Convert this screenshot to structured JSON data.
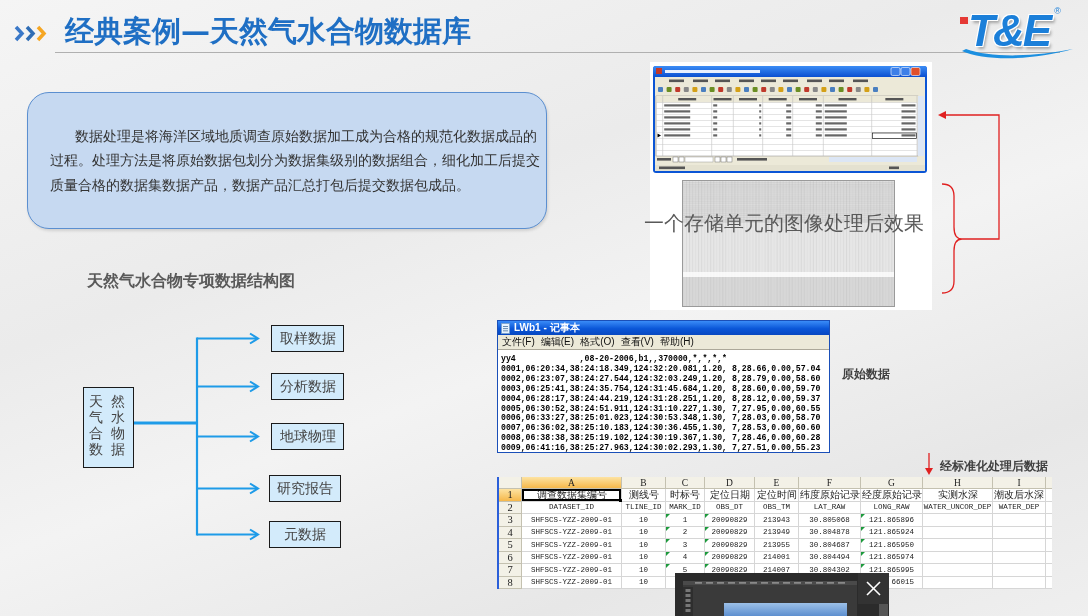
{
  "header": {
    "title": "经典案例—天然气水合物数据库",
    "logo": {
      "text": "T&E",
      "mark": "®"
    }
  },
  "intro_card": {
    "text": "数据处理是将海洋区域地质调查原始数据加工成为合格的规范化数据成品的过程。处理方法是将原始数据包划分为数据集级别的数据组合，细化加工后提交质量合格的数据集数据产品，数据产品汇总打包后提交数据包成品。"
  },
  "structure_diagram": {
    "title": "天然气水合物专项数据结构图",
    "root": "天然气水合物数据",
    "children": [
      "取样数据",
      "分析数据",
      "地球物理",
      "研究报告",
      "元数据"
    ]
  },
  "image_panel": {
    "caption": "一个存储单元的图像处理后效果"
  },
  "notepad": {
    "title": "LWb1 - 记事本",
    "menu": [
      "文件(F)",
      "编辑(E)",
      "格式(O)",
      "查看(V)",
      "帮助(H)"
    ],
    "lines": [
      "yy4             ,08-20-2006,b1,,370000,*,*,*,*",
      "0001,06:20:34,38:24:18.349,124:32:20.081,1.20, 8,28.66,0.00,57.04",
      "0002,06:23:07,38:24:27.544,124:32:03.249,1.20, 8,28.79,0.00,58.60",
      "0003,06:25:41,38:24:35.754,124:31:45.684,1.20, 8,28.60,0.00,59.70",
      "0004,06:28:17,38:24:44.219,124:31:28.251,1.20, 8,28.12,0.00,59.37",
      "0005,06:30:52,38:24:51.911,124:31:10.227,1.30, 7,27.95,0.00,60.55",
      "0006,06:33:27,38:25:01.023,124:30:53.348,1.30, 7,28.03,0.00,58.70",
      "0007,06:36:02,38:25:10.183,124:30:36.455,1.30, 7,28.53,0.00,60.60",
      "0008,06:38:38,38:25:19.102,124:30:19.367,1.30, 7,28.46,0.00,60.28",
      "0009,06:41:16,38:25:27.963,124:30:02.293,1.30, 7,27.51,0.00,55.23"
    ]
  },
  "raw_data_label": "原始数据",
  "spreadsheet": {
    "label": "经标准化处理后数据",
    "columns": [
      {
        "letter": "A",
        "selected": true,
        "flagged": false
      },
      {
        "letter": "B",
        "selected": false,
        "flagged": false
      },
      {
        "letter": "C",
        "selected": false,
        "flagged": true
      },
      {
        "letter": "D",
        "selected": false,
        "flagged": true
      },
      {
        "letter": "E",
        "selected": false,
        "flagged": false
      },
      {
        "letter": "F",
        "selected": false,
        "flagged": false
      },
      {
        "letter": "G",
        "selected": false,
        "flagged": true
      },
      {
        "letter": "H",
        "selected": false,
        "flagged": false
      },
      {
        "letter": "I",
        "selected": false,
        "flagged": false
      }
    ],
    "rows": [
      {
        "number": "1",
        "selected": true,
        "kind": "label",
        "cells": [
          "调查数据集编号",
          "测线号",
          "时标号",
          "定位日期",
          "定位时间",
          "纬度原始记录",
          "经度原始记录",
          "实测水深",
          "潮改后水深"
        ]
      },
      {
        "number": "2",
        "selected": false,
        "kind": "field",
        "cells": [
          "DATASET_ID",
          "TLINE_ID",
          "MARK_ID",
          "OBS_DT",
          "OBS_TM",
          "LAT_RAW",
          "LONG_RAW",
          "WATER_UNCOR_DEP",
          "WATER_DEP"
        ]
      },
      {
        "number": "3",
        "selected": false,
        "kind": "data",
        "cells": [
          "SHFSCS-YZZ-2009-01",
          "10",
          "1",
          "20090829",
          "213943",
          "30.805068",
          "121.865896"
        ]
      },
      {
        "number": "4",
        "selected": false,
        "kind": "data",
        "cells": [
          "SHFSCS-YZZ-2009-01",
          "10",
          "2",
          "20090829",
          "213949",
          "30.804878",
          "121.865924"
        ]
      },
      {
        "number": "5",
        "selected": false,
        "kind": "data",
        "cells": [
          "SHFSCS-YZZ-2009-01",
          "10",
          "3",
          "20090829",
          "213955",
          "30.804687",
          "121.865950"
        ]
      },
      {
        "number": "6",
        "selected": false,
        "kind": "data",
        "cells": [
          "SHFSCS-YZZ-2009-01",
          "10",
          "4",
          "20090829",
          "214001",
          "30.804494",
          "121.865974"
        ]
      },
      {
        "number": "7",
        "selected": false,
        "kind": "data",
        "cells": [
          "SHFSCS-YZZ-2009-01",
          "10",
          "5",
          "20090829",
          "214007",
          "30.804302",
          "121.865995"
        ]
      },
      {
        "number": "8",
        "selected": false,
        "kind": "data",
        "cells": [
          "SHFSCS-YZZ-2009-01",
          "10",
          null,
          null,
          null,
          null,
          "66015"
        ]
      }
    ]
  }
}
